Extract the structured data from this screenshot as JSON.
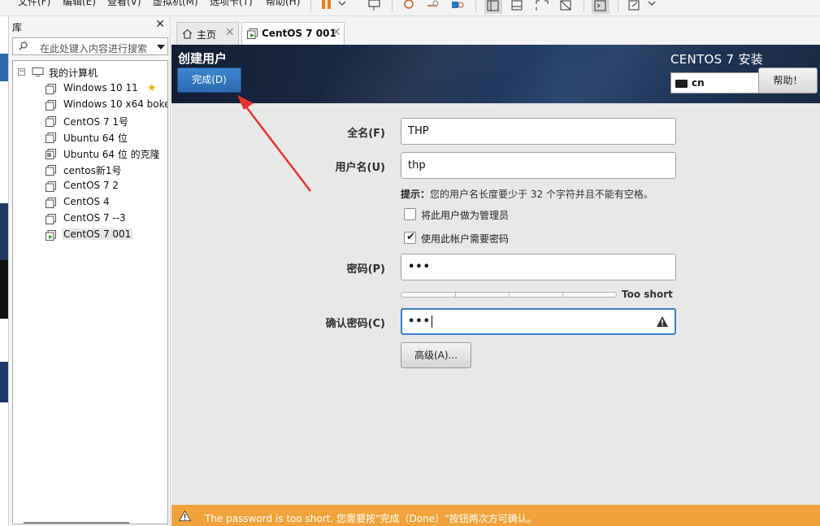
{
  "menubar": {
    "items": [
      "文件(F)",
      "编辑(E)",
      "查看(V)",
      "虚拟机(M)",
      "选项卡(T)",
      "帮助(H)"
    ]
  },
  "library": {
    "title": "库",
    "search_placeholder": "在此处键入内容进行搜索",
    "root_label": "我的计算机",
    "vms": [
      {
        "label": "Windows 10   11"
      },
      {
        "label": "Windows 10 x64 boke"
      },
      {
        "label": "CentOS 7 1号"
      },
      {
        "label": "Ubuntu 64 位"
      },
      {
        "label": "Ubuntu 64 位 的克隆"
      },
      {
        "label": "centos新1号"
      },
      {
        "label": "CentOS 7 2"
      },
      {
        "label": "CentOS 4"
      },
      {
        "label": "CentOS 7  --3"
      },
      {
        "label": "CentOS 7  001"
      }
    ]
  },
  "tabs": [
    {
      "label": "主页"
    },
    {
      "label": "CentOS 7  001"
    }
  ],
  "installer": {
    "page_title": "创建用户",
    "done_label": "完成(D)",
    "product_title": "CENTOS 7 安装",
    "keyboard_layout": "cn",
    "help_label": "帮助！",
    "fullname_label": "全名(F)",
    "fullname_value": "THP",
    "username_label": "用户名(U)",
    "username_value": "thp",
    "hint_prefix": "提示：",
    "hint_text": "您的用户名长度要少于 32 个字符并且不能有空格。",
    "admin_label": "将此用户做为管理员",
    "admin_checked": false,
    "require_password_label": "使用此帐户需要密码",
    "require_password_checked": true,
    "password_label": "密码(P)",
    "password_value": "•••",
    "strength_label": "Too short",
    "confirm_label": "确认密码(C)",
    "confirm_value": "•••",
    "advanced_label": "高级(A)...",
    "status_message": "The password is too short. 您需要按\"完成（Done）\"按钮两次方可确认。"
  },
  "colors": {
    "header_dark": "#1c2c49",
    "done_button": "#3578c2",
    "status_bar": "#f0a33a",
    "annotation_arrow": "#e8312f"
  }
}
